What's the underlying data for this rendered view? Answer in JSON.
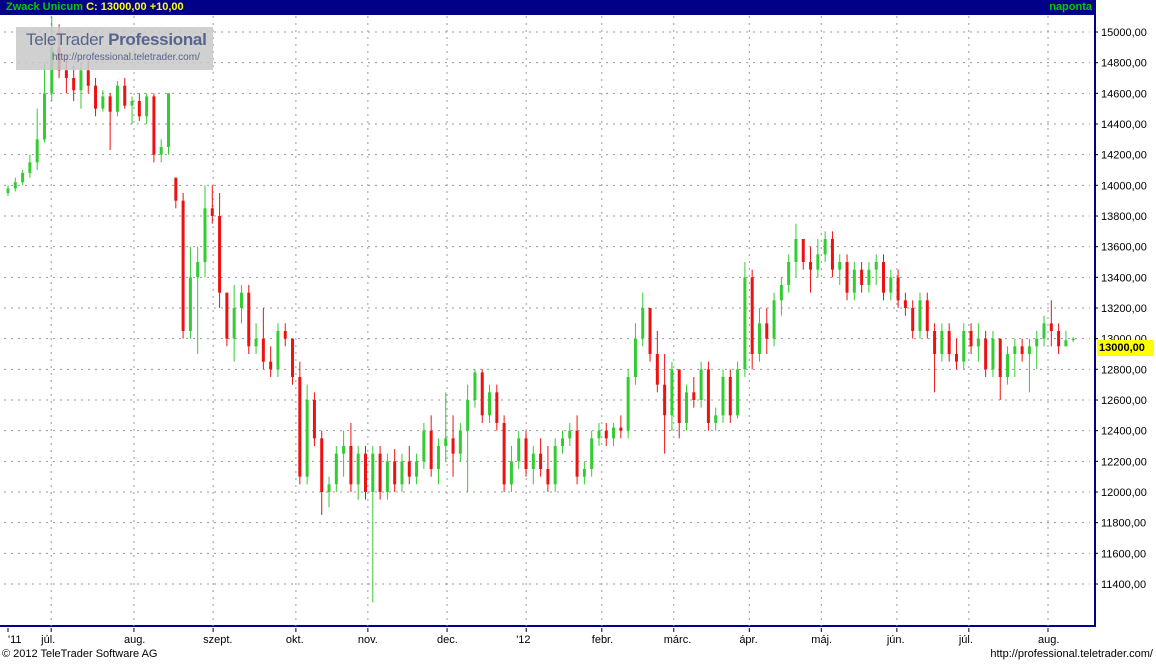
{
  "header": {
    "symbol": "Zwack Unicum",
    "quote": "C: 13000,00 +10,00",
    "frequency": "naponta"
  },
  "logo": {
    "brand_light": "TeleTrader",
    "brand_bold": "Professional",
    "url": "http://professional.teletrader.com/"
  },
  "footer": {
    "copyright": "© 2012 TeleTrader Software AG",
    "site": "http://professional.teletrader.com/"
  },
  "colors": {
    "up": "#33cc33",
    "down": "#ee1111",
    "neutral": "#66cccc",
    "frame": "#000088",
    "grid": "#9a9a9a",
    "last_price": "#ffff00"
  },
  "chart_data": {
    "type": "candlestick",
    "last_price_label": "13000,00",
    "y_ticks": [
      "15000,00",
      "14800,00",
      "14600,00",
      "14400,00",
      "14200,00",
      "14000,00",
      "13800,00",
      "13600,00",
      "13400,00",
      "13200,00",
      "13000,00",
      "12800,00",
      "12600,00",
      "12400,00",
      "12200,00",
      "12000,00",
      "11800,00",
      "11600,00",
      "11400,00"
    ],
    "y_tick_values": [
      15000,
      14800,
      14600,
      14400,
      14200,
      14000,
      13800,
      13600,
      13400,
      13200,
      13000,
      12800,
      12600,
      12400,
      12200,
      12000,
      11800,
      11600,
      11400
    ],
    "ylim": [
      11300,
      15100
    ],
    "x_ticks": [
      "'11",
      "júl.",
      "aug.",
      "szept.",
      "okt.",
      "nov.",
      "dec.",
      "'12",
      "febr.",
      "márc.",
      "ápr.",
      "máj.",
      "jún.",
      "júl.",
      "aug."
    ],
    "x_tick_index": [
      0,
      12,
      35,
      57,
      80,
      100,
      122,
      144,
      165,
      185,
      206,
      226,
      247,
      267,
      289
    ],
    "num_days": 300,
    "candles": [
      [
        13950,
        14000,
        13930,
        13980
      ],
      [
        13980,
        14050,
        13960,
        14020
      ],
      [
        14020,
        14100,
        14000,
        14080
      ],
      [
        14080,
        14200,
        14050,
        14150
      ],
      [
        14150,
        14500,
        14100,
        14300
      ],
      [
        14300,
        14800,
        14280,
        14600
      ],
      [
        14600,
        15100,
        14550,
        14900
      ],
      [
        14900,
        15050,
        14700,
        14750
      ],
      [
        14750,
        14850,
        14600,
        14700
      ],
      [
        14700,
        14780,
        14550,
        14620
      ],
      [
        14620,
        14800,
        14500,
        14750
      ],
      [
        14750,
        14820,
        14600,
        14650
      ],
      [
        14650,
        14700,
        14450,
        14500
      ],
      [
        14500,
        14620,
        14480,
        14580
      ],
      [
        14580,
        14600,
        14230,
        14480
      ],
      [
        14480,
        14680,
        14450,
        14650
      ],
      [
        14650,
        14700,
        14500,
        14520
      ],
      [
        14520,
        14580,
        14400,
        14550
      ],
      [
        14550,
        14600,
        14420,
        14450
      ],
      [
        14450,
        14600,
        14400,
        14580
      ],
      [
        14580,
        14600,
        14150,
        14200
      ],
      [
        14200,
        14300,
        14150,
        14250
      ],
      [
        14250,
        14600,
        14200,
        14600
      ],
      [
        14050,
        14050,
        13850,
        13900
      ],
      [
        13900,
        13950,
        13000,
        13050
      ],
      [
        13050,
        13600,
        13000,
        13400
      ],
      [
        13400,
        13600,
        12900,
        13500
      ],
      [
        13500,
        14000,
        13400,
        13850
      ],
      [
        13850,
        14000,
        13750,
        13800
      ],
      [
        13800,
        13950,
        13200,
        13300
      ],
      [
        13300,
        13300,
        12950,
        13000
      ],
      [
        13000,
        13350,
        12850,
        13200
      ],
      [
        13200,
        13350,
        13100,
        13300
      ],
      [
        13300,
        13350,
        12900,
        12950
      ],
      [
        12950,
        13100,
        12900,
        13000
      ],
      [
        13000,
        13200,
        12800,
        12850
      ],
      [
        12850,
        12950,
        12750,
        12800
      ],
      [
        12800,
        13100,
        12750,
        13050
      ],
      [
        13050,
        13100,
        12950,
        13000
      ],
      [
        13000,
        13000,
        12700,
        12750
      ],
      [
        12750,
        12850,
        12050,
        12100
      ],
      [
        12100,
        12700,
        12050,
        12600
      ],
      [
        12600,
        12650,
        12300,
        12350
      ],
      [
        12350,
        12400,
        11850,
        12000
      ],
      [
        12000,
        12100,
        11900,
        12050
      ],
      [
        12050,
        12300,
        12000,
        12250
      ],
      [
        12250,
        12400,
        12100,
        12300
      ],
      [
        12300,
        12450,
        12000,
        12050
      ],
      [
        12050,
        12300,
        11950,
        12250
      ],
      [
        12250,
        12300,
        11950,
        12000
      ],
      [
        12000,
        12300,
        11280,
        12250
      ],
      [
        12250,
        12300,
        11950,
        12000
      ],
      [
        12000,
        12250,
        11950,
        12200
      ],
      [
        12200,
        12280,
        12000,
        12050
      ],
      [
        12050,
        12250,
        12000,
        12200
      ],
      [
        12200,
        12300,
        12050,
        12100
      ],
      [
        12100,
        12250,
        12050,
        12200
      ],
      [
        12200,
        12450,
        12150,
        12400
      ],
      [
        12400,
        12500,
        12100,
        12150
      ],
      [
        12150,
        12350,
        12050,
        12300
      ],
      [
        12300,
        12650,
        12200,
        12350
      ],
      [
        12350,
        12500,
        12100,
        12250
      ],
      [
        12250,
        12450,
        12200,
        12400
      ],
      [
        12400,
        12700,
        12000,
        12600
      ],
      [
        12600,
        12800,
        12550,
        12780
      ],
      [
        12780,
        12800,
        12450,
        12500
      ],
      [
        12500,
        12700,
        12450,
        12650
      ],
      [
        12650,
        12700,
        12400,
        12450
      ],
      [
        12450,
        12500,
        12000,
        12050
      ],
      [
        12050,
        12300,
        12000,
        12200
      ],
      [
        12200,
        12400,
        12150,
        12350
      ],
      [
        12350,
        12400,
        12100,
        12150
      ],
      [
        12150,
        12300,
        12050,
        12250
      ],
      [
        12250,
        12350,
        12100,
        12150
      ],
      [
        12150,
        12300,
        12000,
        12050
      ],
      [
        12050,
        12350,
        12000,
        12300
      ],
      [
        12300,
        12400,
        12250,
        12350
      ],
      [
        12350,
        12450,
        12300,
        12400
      ],
      [
        12400,
        12500,
        12050,
        12100
      ],
      [
        12100,
        12200,
        12050,
        12150
      ],
      [
        12150,
        12400,
        12100,
        12350
      ],
      [
        12350,
        12450,
        12300,
        12400
      ],
      [
        12400,
        12450,
        12300,
        12350
      ],
      [
        12350,
        12450,
        12300,
        12420
      ],
      [
        12420,
        12500,
        12350,
        12400
      ],
      [
        12400,
        12800,
        12350,
        12750
      ],
      [
        12750,
        13100,
        12700,
        13000
      ],
      [
        13000,
        13300,
        12950,
        13200
      ],
      [
        13200,
        13200,
        12850,
        12900
      ],
      [
        12900,
        13050,
        12650,
        12700
      ],
      [
        12700,
        12900,
        12250,
        12500
      ],
      [
        12500,
        12850,
        12400,
        12800
      ],
      [
        12800,
        12800,
        12350,
        12450
      ],
      [
        12450,
        12700,
        12400,
        12650
      ],
      [
        12650,
        12750,
        12550,
        12600
      ],
      [
        12600,
        12850,
        12550,
        12800
      ],
      [
        12800,
        12850,
        12400,
        12450
      ],
      [
        12450,
        12550,
        12400,
        12500
      ],
      [
        12500,
        12800,
        12450,
        12750
      ],
      [
        12750,
        12800,
        12450,
        12500
      ],
      [
        12500,
        12850,
        12480,
        12800
      ],
      [
        12800,
        13500,
        12750,
        13400
      ],
      [
        13400,
        13450,
        12800,
        12900
      ],
      [
        12900,
        13200,
        12850,
        13100
      ],
      [
        13100,
        13200,
        12900,
        13000
      ],
      [
        13000,
        13300,
        12950,
        13250
      ],
      [
        13250,
        13400,
        13150,
        13350
      ],
      [
        13350,
        13550,
        13300,
        13500
      ],
      [
        13500,
        13750,
        13400,
        13650
      ],
      [
        13650,
        13650,
        13450,
        13500
      ],
      [
        13500,
        13600,
        13300,
        13450
      ],
      [
        13450,
        13650,
        13400,
        13550
      ],
      [
        13550,
        13700,
        13500,
        13650
      ],
      [
        13650,
        13700,
        13400,
        13450
      ],
      [
        13450,
        13550,
        13350,
        13500
      ],
      [
        13500,
        13550,
        13250,
        13300
      ],
      [
        13300,
        13500,
        13250,
        13450
      ],
      [
        13450,
        13500,
        13300,
        13350
      ],
      [
        13350,
        13500,
        13300,
        13450
      ],
      [
        13450,
        13550,
        13350,
        13500
      ],
      [
        13500,
        13550,
        13250,
        13300
      ],
      [
        13300,
        13450,
        13250,
        13400
      ],
      [
        13400,
        13450,
        13200,
        13250
      ],
      [
        13250,
        13300,
        13150,
        13200
      ],
      [
        13200,
        13250,
        13000,
        13050
      ],
      [
        13050,
        13300,
        13000,
        13250
      ],
      [
        13250,
        13300,
        13000,
        13050
      ],
      [
        13050,
        13100,
        12650,
        12900
      ],
      [
        12900,
        13100,
        12850,
        13050
      ],
      [
        13050,
        13100,
        12850,
        12900
      ],
      [
        12900,
        13000,
        12800,
        12850
      ],
      [
        12850,
        13100,
        12800,
        13050
      ],
      [
        13050,
        13100,
        12900,
        12950
      ],
      [
        12950,
        13100,
        12850,
        13000
      ],
      [
        13000,
        13050,
        12750,
        12800
      ],
      [
        12800,
        13050,
        12750,
        13000
      ],
      [
        13000,
        13000,
        12600,
        12750
      ],
      [
        12750,
        12950,
        12700,
        12900
      ],
      [
        12900,
        13000,
        12750,
        12950
      ],
      [
        12950,
        13000,
        12850,
        12900
      ],
      [
        12900,
        13000,
        12650,
        12950
      ],
      [
        12950,
        13050,
        12800,
        13000
      ],
      [
        13000,
        13150,
        12950,
        13100
      ],
      [
        13100,
        13250,
        12950,
        13050
      ],
      [
        13050,
        13100,
        12900,
        12950
      ],
      [
        12950,
        13050,
        12950,
        12990
      ],
      [
        12990,
        13010,
        12980,
        13000
      ]
    ]
  }
}
